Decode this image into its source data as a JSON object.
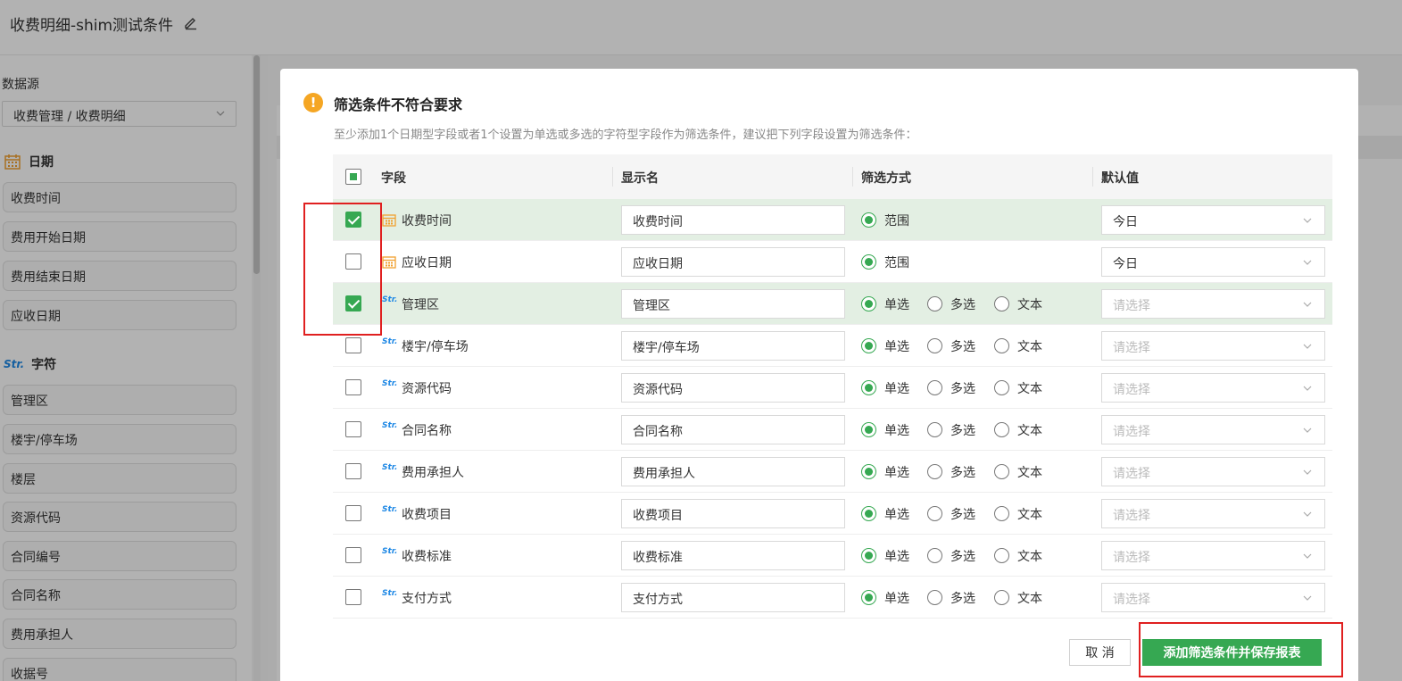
{
  "page": {
    "title": "收费明细-shim测试条件",
    "datasource_label": "数据源",
    "datasource_value": "收费管理 / 收费明细",
    "date_section": "日期",
    "char_section": "字符",
    "date_fields": [
      "收费时间",
      "费用开始日期",
      "费用结束日期",
      "应收日期"
    ],
    "char_fields": [
      "管理区",
      "楼宇/停车场",
      "楼层",
      "资源代码",
      "合同编号",
      "合同名称",
      "费用承担人",
      "收据号"
    ]
  },
  "modal": {
    "title": "筛选条件不符合要求",
    "description": "至少添加1个日期型字段或者1个设置为单选或多选的字符型字段作为筛选条件，建议把下列字段设置为筛选条件：",
    "headers": {
      "field": "字段",
      "display_name": "显示名",
      "filter_mode": "筛选方式",
      "default_value": "默认值"
    },
    "radio_labels": {
      "range": "范围",
      "single": "单选",
      "multi": "多选",
      "text": "文本"
    },
    "rows": [
      {
        "field": "收费时间",
        "type": "date",
        "checked": true,
        "display": "收费时间",
        "mode": "range",
        "default": "今日"
      },
      {
        "field": "应收日期",
        "type": "date",
        "checked": false,
        "display": "应收日期",
        "mode": "range",
        "default": "今日"
      },
      {
        "field": "管理区",
        "type": "str",
        "checked": true,
        "display": "管理区",
        "mode": "single",
        "default": "请选择"
      },
      {
        "field": "楼宇/停车场",
        "type": "str",
        "checked": false,
        "display": "楼宇/停车场",
        "mode": "single",
        "default": "请选择"
      },
      {
        "field": "资源代码",
        "type": "str",
        "checked": false,
        "display": "资源代码",
        "mode": "single",
        "default": "请选择"
      },
      {
        "field": "合同名称",
        "type": "str",
        "checked": false,
        "display": "合同名称",
        "mode": "single",
        "default": "请选择"
      },
      {
        "field": "费用承担人",
        "type": "str",
        "checked": false,
        "display": "费用承担人",
        "mode": "single",
        "default": "请选择"
      },
      {
        "field": "收费项目",
        "type": "str",
        "checked": false,
        "display": "收费项目",
        "mode": "single",
        "default": "请选择"
      },
      {
        "field": "收费标准",
        "type": "str",
        "checked": false,
        "display": "收费标准",
        "mode": "single",
        "default": "请选择"
      },
      {
        "field": "支付方式",
        "type": "str",
        "checked": false,
        "display": "支付方式",
        "mode": "single",
        "default": "请选择"
      }
    ],
    "str_icon_text": "Str.",
    "cancel_label": "取 消",
    "save_label": "添加筛选条件并保存报表"
  },
  "colors": {
    "accent": "#36a852",
    "selected_row": "#e3efe3",
    "warning": "#f5a623",
    "highlight": "#e02020",
    "str_icon": "#1e88e5",
    "date_icon": "#f0a030"
  }
}
